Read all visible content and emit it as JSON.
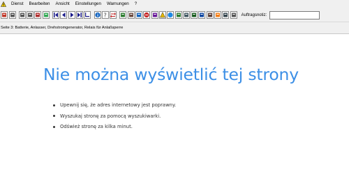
{
  "menu": {
    "warning_icon": "warning-triangle-icon",
    "items": [
      "Dienst",
      "Bearbeiten",
      "Ansicht",
      "Einstellungen",
      "Warnungen",
      "?"
    ]
  },
  "toolbar": {
    "buttons": [
      {
        "icon": "tools-icon",
        "color": "#c0392b"
      },
      {
        "icon": "printer-icon",
        "color": "#555555"
      },
      {
        "icon": "new-page-icon",
        "color": "#555555"
      },
      {
        "icon": "copy-icon",
        "color": "#555555"
      },
      {
        "icon": "car-icon",
        "color": "#b03030"
      },
      {
        "icon": "car-list-icon",
        "color": "#3a5"
      },
      {
        "icon": "first-icon",
        "color": "#1a1a8a"
      },
      {
        "icon": "previous-icon",
        "color": "#1a1a8a"
      },
      {
        "icon": "next-icon",
        "color": "#1a1a8a"
      },
      {
        "icon": "last-icon",
        "color": "#1a1a8a"
      },
      {
        "icon": "jump-icon",
        "color": "#1a1a8a"
      },
      {
        "icon": "info-icon",
        "color": "#1565c0"
      },
      {
        "icon": "help-icon",
        "color": "#444444"
      },
      {
        "icon": "transfer-icon",
        "color": "#c62828"
      },
      {
        "icon": "diagram-icon",
        "color": "#2e7d32"
      },
      {
        "icon": "component-icon",
        "color": "#6d4c41"
      },
      {
        "icon": "search-doc-icon",
        "color": "#1565c0"
      },
      {
        "icon": "stop-icon",
        "color": "#c62828"
      },
      {
        "icon": "image-icon",
        "color": "#6a1b9a"
      },
      {
        "icon": "warning-icon",
        "color": "#e6b800"
      },
      {
        "icon": "globe-icon",
        "color": "#1e88e5"
      },
      {
        "icon": "sync-icon",
        "color": "#2e7d32"
      },
      {
        "icon": "repair-icon",
        "color": "#455a64"
      },
      {
        "icon": "oil-icon",
        "color": "#1b5e20"
      },
      {
        "icon": "fish-icon",
        "color": "#0d47a1"
      },
      {
        "icon": "clipboard-icon",
        "color": "#5d4037"
      },
      {
        "icon": "note-icon",
        "color": "#f57f17"
      },
      {
        "icon": "calculator-icon",
        "color": "#37474f"
      },
      {
        "icon": "document-icon",
        "color": "#555555"
      }
    ],
    "auftragsnotiz_label": "Auftragsnotiz:",
    "auftragsnotiz_value": ""
  },
  "status": {
    "text": "Seite 3: Batterie, Anlasser, Drehstromgenerator, Relais für Anlaßsperre"
  },
  "error_page": {
    "title": "Nie można wyświetlić tej strony",
    "bullets": [
      "Upewnij się, że adres internetowy  jest poprawny.",
      "Wyszukaj stronę za pomocą wyszukiwarki.",
      "Odśwież stronę za kilka minut."
    ],
    "title_color": "#3c8fe6"
  }
}
